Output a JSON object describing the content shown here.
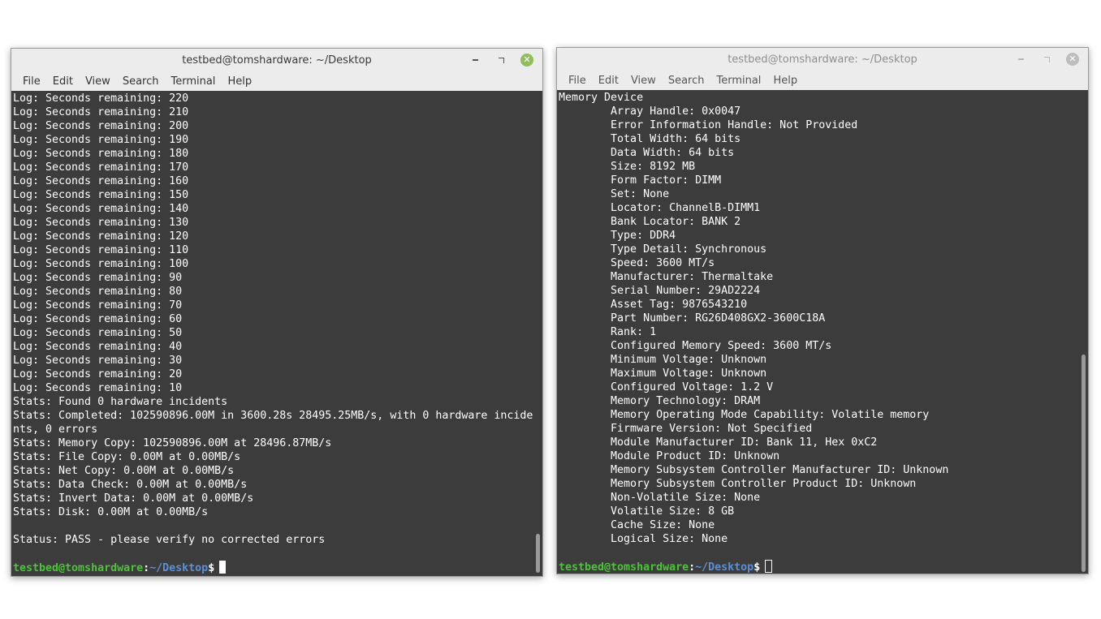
{
  "left": {
    "title": "testbed@tomshardware: ~/Desktop",
    "menu": [
      "File",
      "Edit",
      "View",
      "Search",
      "Terminal",
      "Help"
    ],
    "lines": [
      "Log: Seconds remaining: 220",
      "Log: Seconds remaining: 210",
      "Log: Seconds remaining: 200",
      "Log: Seconds remaining: 190",
      "Log: Seconds remaining: 180",
      "Log: Seconds remaining: 170",
      "Log: Seconds remaining: 160",
      "Log: Seconds remaining: 150",
      "Log: Seconds remaining: 140",
      "Log: Seconds remaining: 130",
      "Log: Seconds remaining: 120",
      "Log: Seconds remaining: 110",
      "Log: Seconds remaining: 100",
      "Log: Seconds remaining: 90",
      "Log: Seconds remaining: 80",
      "Log: Seconds remaining: 70",
      "Log: Seconds remaining: 60",
      "Log: Seconds remaining: 50",
      "Log: Seconds remaining: 40",
      "Log: Seconds remaining: 30",
      "Log: Seconds remaining: 20",
      "Log: Seconds remaining: 10",
      "Stats: Found 0 hardware incidents",
      "Stats: Completed: 102590896.00M in 3600.28s 28495.25MB/s, with 0 hardware incide",
      "nts, 0 errors",
      "Stats: Memory Copy: 102590896.00M at 28496.87MB/s",
      "Stats: File Copy: 0.00M at 0.00MB/s",
      "Stats: Net Copy: 0.00M at 0.00MB/s",
      "Stats: Data Check: 0.00M at 0.00MB/s",
      "Stats: Invert Data: 0.00M at 0.00MB/s",
      "Stats: Disk: 0.00M at 0.00MB/s",
      "",
      "Status: PASS - please verify no corrected errors",
      ""
    ],
    "prompt": {
      "user": "testbed@tomshardware",
      "colon": ":",
      "path": "~/Desktop",
      "dollar": "$"
    }
  },
  "right": {
    "title": "testbed@tomshardware: ~/Desktop",
    "menu": [
      "File",
      "Edit",
      "View",
      "Search",
      "Terminal",
      "Help"
    ],
    "lines": [
      "Memory Device",
      "        Array Handle: 0x0047",
      "        Error Information Handle: Not Provided",
      "        Total Width: 64 bits",
      "        Data Width: 64 bits",
      "        Size: 8192 MB",
      "        Form Factor: DIMM",
      "        Set: None",
      "        Locator: ChannelB-DIMM1",
      "        Bank Locator: BANK 2",
      "        Type: DDR4",
      "        Type Detail: Synchronous",
      "        Speed: 3600 MT/s",
      "        Manufacturer: Thermaltake",
      "        Serial Number: 29AD2224",
      "        Asset Tag: 9876543210",
      "        Part Number: RG26D408GX2-3600C18A",
      "        Rank: 1",
      "        Configured Memory Speed: 3600 MT/s",
      "        Minimum Voltage: Unknown",
      "        Maximum Voltage: Unknown",
      "        Configured Voltage: 1.2 V",
      "        Memory Technology: DRAM",
      "        Memory Operating Mode Capability: Volatile memory",
      "        Firmware Version: Not Specified",
      "        Module Manufacturer ID: Bank 11, Hex 0xC2",
      "        Module Product ID: Unknown",
      "        Memory Subsystem Controller Manufacturer ID: Unknown",
      "        Memory Subsystem Controller Product ID: Unknown",
      "        Non-Volatile Size: None",
      "        Volatile Size: 8 GB",
      "        Cache Size: None",
      "        Logical Size: None",
      ""
    ],
    "prompt": {
      "user": "testbed@tomshardware",
      "colon": ":",
      "path": "~/Desktop",
      "dollar": "$"
    }
  }
}
